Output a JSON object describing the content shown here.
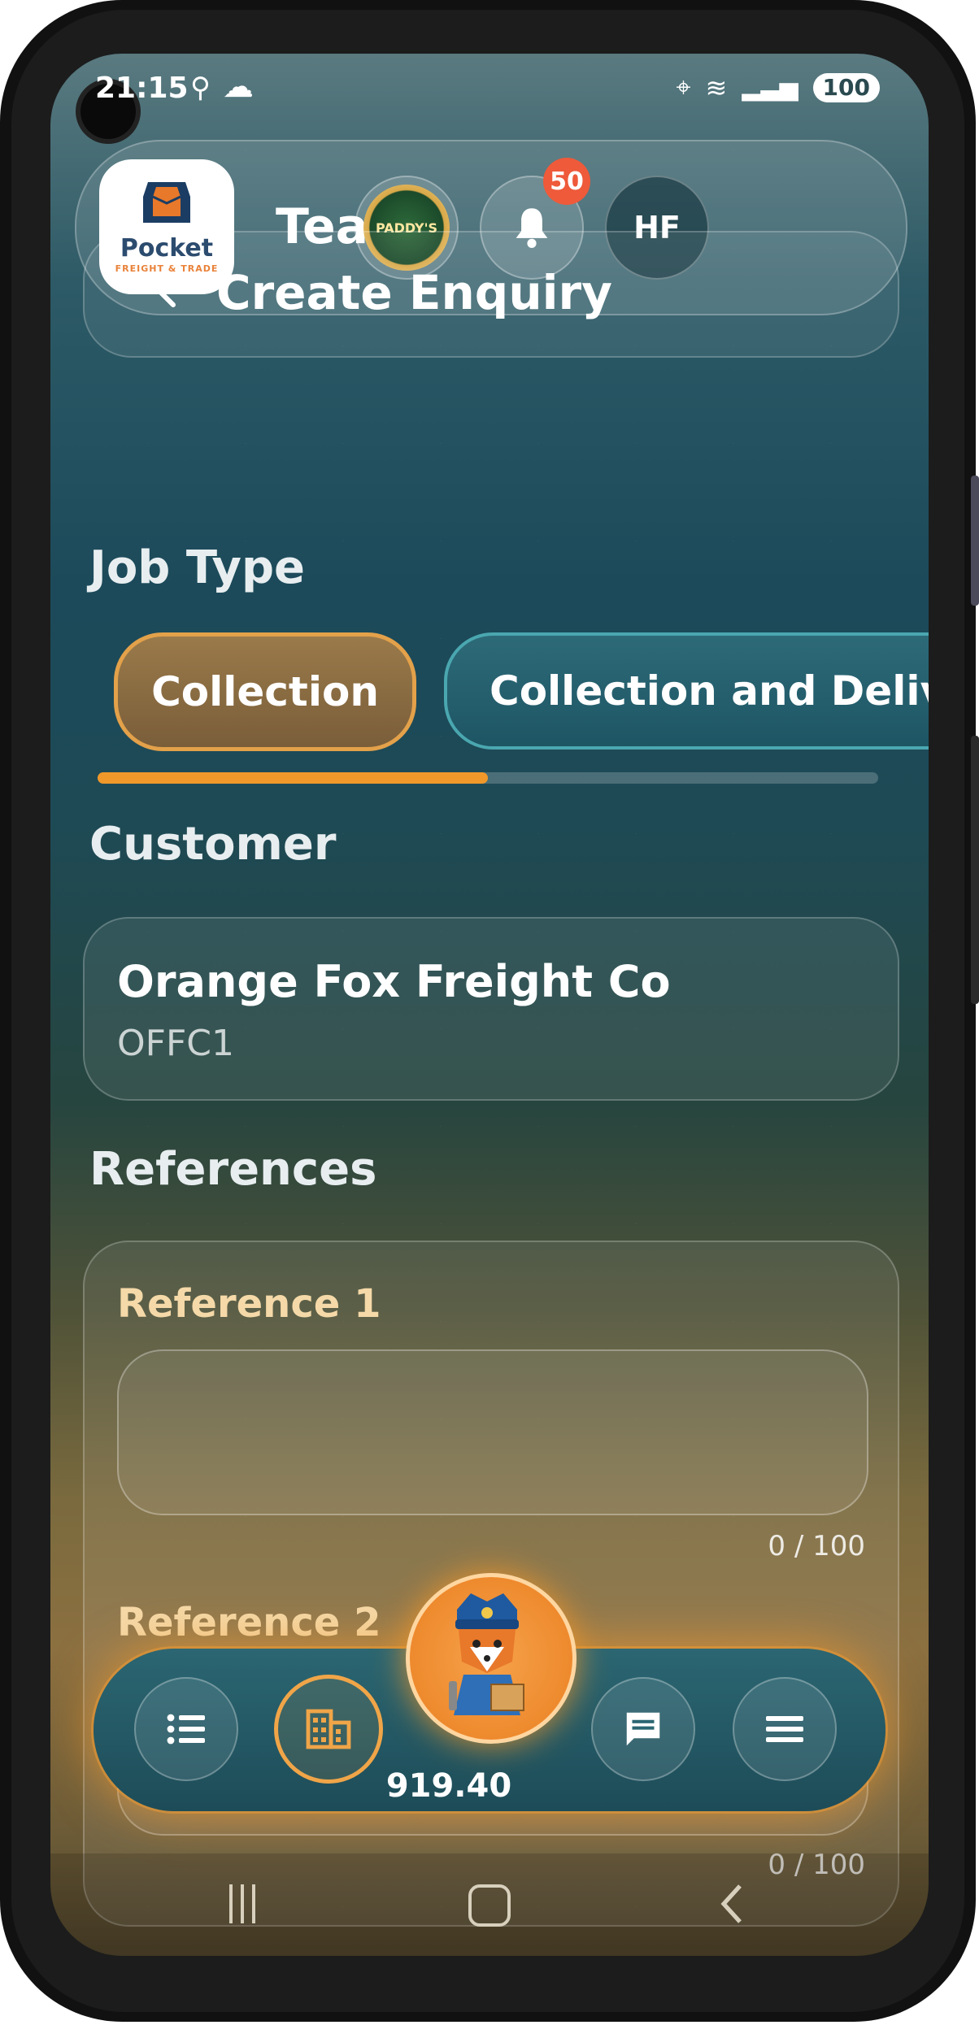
{
  "status_bar": {
    "time": "21:15",
    "battery": "100"
  },
  "header": {
    "title": "Team",
    "notification_count": "50",
    "avatar_initials": "HF",
    "logo_line1": "Pocket",
    "logo_line2": "FREIGHT & TRADE",
    "company_badge_text": "PADDY'S"
  },
  "page": {
    "back_icon": "chevron-left-icon",
    "title": "Create Enquiry"
  },
  "job_type": {
    "label": "Job Type",
    "options": [
      "Collection",
      "Collection and Delivery"
    ],
    "selected": "Collection",
    "scroll_fraction": 0.5
  },
  "customer": {
    "label": "Customer",
    "name": "Orange Fox Freight Co",
    "code": "OFFC1"
  },
  "references": {
    "label": "References",
    "fields": [
      {
        "label": "Reference 1",
        "value": "",
        "counter": "0 / 100"
      },
      {
        "label": "Reference 2",
        "value": "",
        "counter": "0 / 100"
      }
    ]
  },
  "bottom_nav": {
    "balance": "919.40",
    "items": [
      "list-icon",
      "building-icon",
      "fox-avatar",
      "chat-icon",
      "menu-icon"
    ],
    "active": "building-icon"
  },
  "colors": {
    "accent": "#f0982a",
    "teal": "#1e5564",
    "badge": "#ee5a3a"
  }
}
